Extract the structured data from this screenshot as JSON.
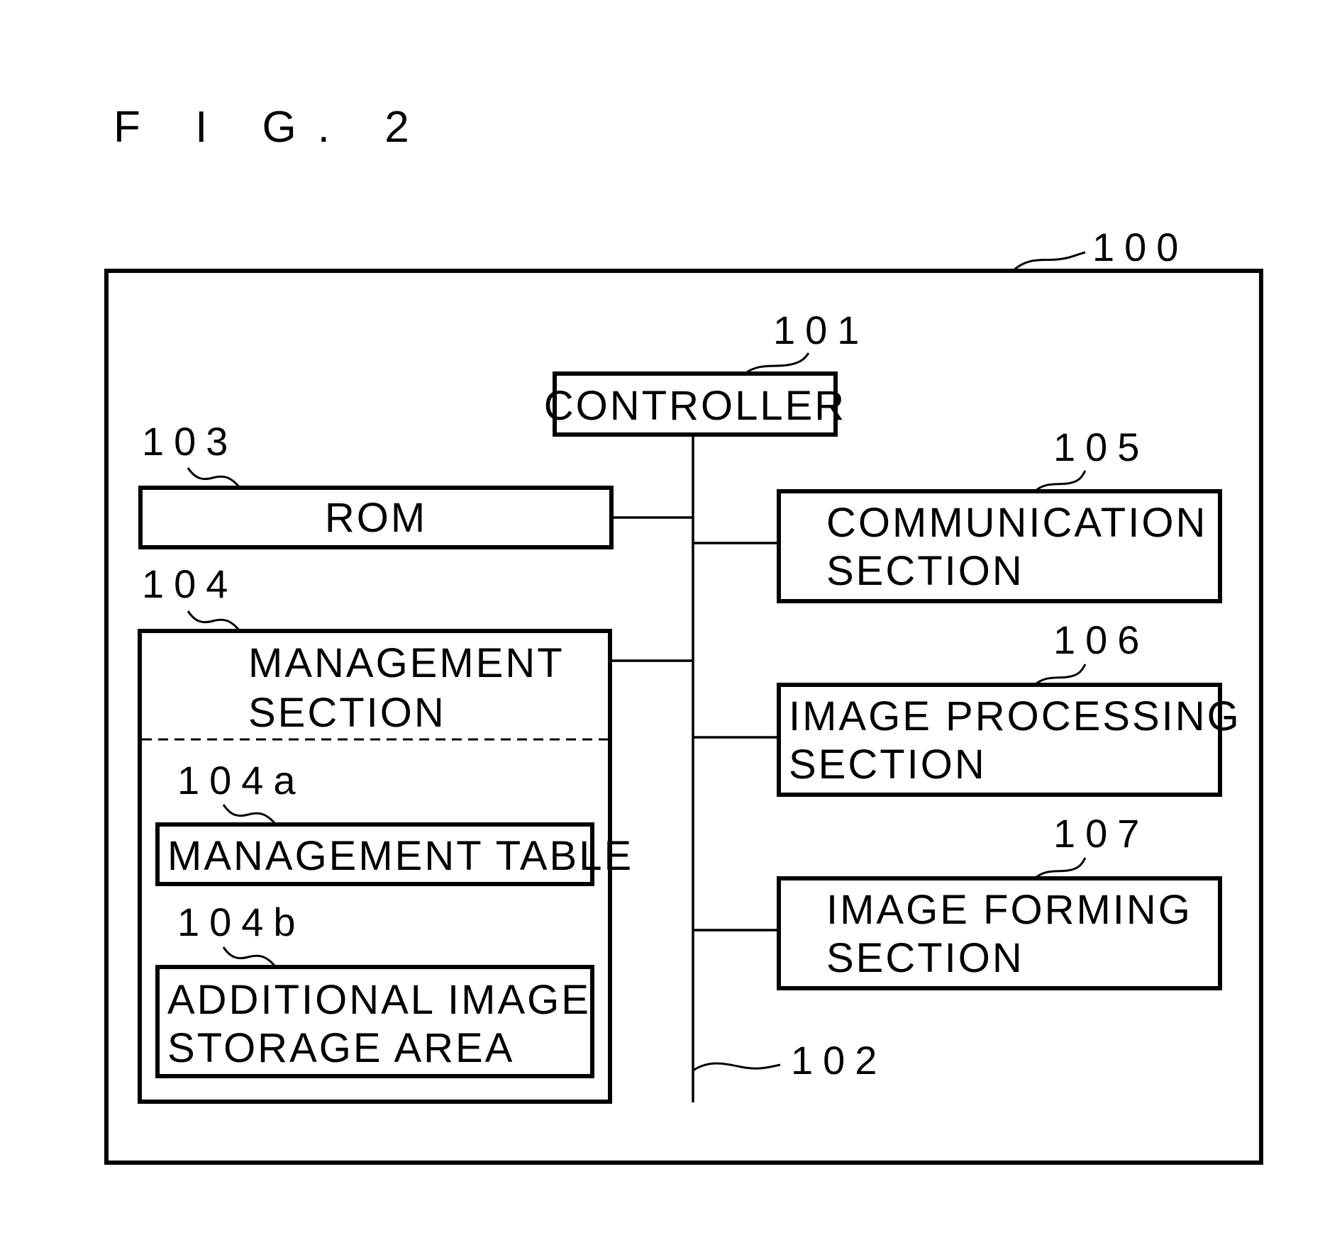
{
  "figure": {
    "title": "F I G. 2"
  },
  "apparatus": {
    "ref": "100"
  },
  "controller": {
    "ref": "101",
    "label": "CONTROLLER"
  },
  "bus": {
    "ref": "102"
  },
  "rom": {
    "ref": "103",
    "label": "ROM"
  },
  "management_section": {
    "ref": "104",
    "label_lines": [
      "MANAGEMENT",
      "SECTION"
    ],
    "management_table": {
      "ref": "104a",
      "label": "MANAGEMENT TABLE"
    },
    "additional_image_storage": {
      "ref": "104b",
      "label_lines": [
        "ADDITIONAL IMAGE",
        "STORAGE AREA"
      ]
    }
  },
  "communication_section": {
    "ref": "105",
    "label_lines": [
      "COMMUNICATION",
      "SECTION"
    ]
  },
  "image_processing_section": {
    "ref": "106",
    "label_lines": [
      "IMAGE PROCESSING",
      "SECTION"
    ]
  },
  "image_forming_section": {
    "ref": "107",
    "label_lines": [
      "IMAGE FORMING",
      "SECTION"
    ]
  }
}
